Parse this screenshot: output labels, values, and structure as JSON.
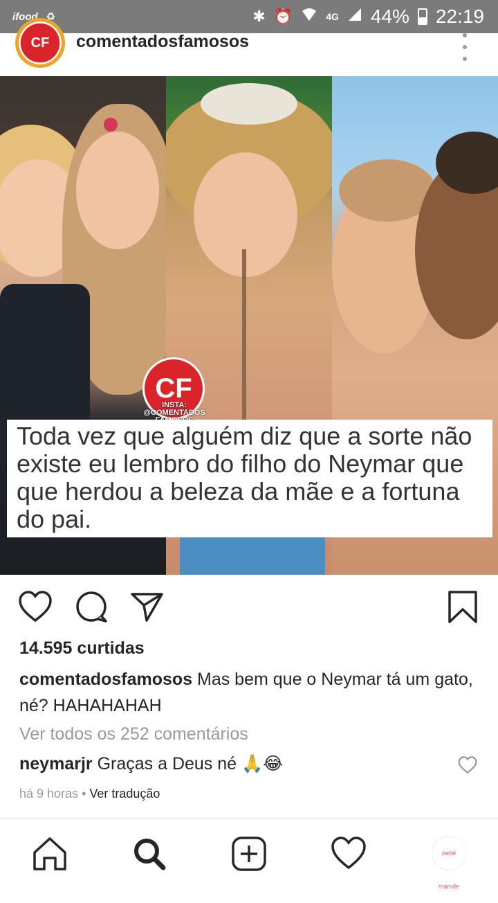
{
  "status_bar": {
    "left_app_label": "ifood",
    "network": "4G",
    "battery": "44%",
    "time": "22:19",
    "icons": [
      "bluetooth-icon",
      "alarm-icon",
      "wifi-icon",
      "signal-icon",
      "battery-icon"
    ]
  },
  "post": {
    "username": "comentadosfamosos",
    "avatar_text": "CF",
    "image_caption": "Toda vez que alguém diz que a sorte não existe eu lembro do filho do Neymar que que herdou a beleza da mãe e a fortuna do pai.",
    "watermark_top": "CF",
    "watermark_sub": "INSTA: @COMENTADOS FAMOSOS",
    "likes": "14.595 curtidas",
    "caption_username": "comentadosfamosos",
    "caption_text": " Mas bem que o Neymar tá um gato, né? HAHAHAHAH",
    "view_comments": "Ver todos os 252 comentários",
    "comment": {
      "username": "neymarjr",
      "text": " Graças a Deus né 🙏😂"
    },
    "time_ago": "há 9 horas",
    "separator": " • ",
    "translate": "Ver tradução"
  },
  "bottom_nav": {
    "profile_label": "bebê mamãe"
  },
  "colors": {
    "accent_red": "#d9252a",
    "status_bar": "#7b7b7b",
    "muted_text": "#999999"
  }
}
